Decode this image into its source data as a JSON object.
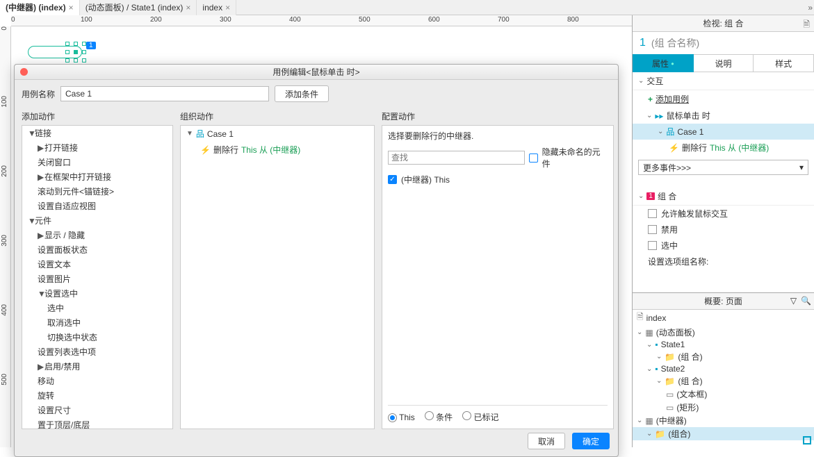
{
  "tabs": [
    {
      "label": "(中继器) (index)",
      "active": true
    },
    {
      "label": "(动态面板) / State1 (index)",
      "active": false
    },
    {
      "label": "index",
      "active": false
    }
  ],
  "ruler_h": [
    "0",
    "100",
    "200",
    "300",
    "400",
    "500",
    "600",
    "700",
    "800"
  ],
  "ruler_v": [
    "0",
    "100",
    "200",
    "300",
    "400",
    "500"
  ],
  "canvas": {
    "badge": "1"
  },
  "dialog": {
    "title": "用例编辑<鼠标单击 时>",
    "case_label": "用例名称",
    "case_name": "Case 1",
    "add_condition": "添加条件",
    "col1_h": "添加动作",
    "col2_h": "组织动作",
    "col3_h": "配置动作",
    "actions_tree": {
      "group1": "链接",
      "g1_items": [
        "打开链接",
        "关闭窗口",
        "在框架中打开链接",
        "滚动到元件<锚链接>",
        "设置自适应视图"
      ],
      "group2": "元件",
      "g2_items": [
        "显示 / 隐藏",
        "设置面板状态",
        "设置文本",
        "设置图片"
      ],
      "g2_sub": "设置选中",
      "g2_sub_items": [
        "选中",
        "取消选中",
        "切换选中状态"
      ],
      "g2_tail": [
        "设置列表选中项",
        "启用/禁用",
        "移动",
        "旋转",
        "设置尺寸",
        "置于顶层/底层"
      ]
    },
    "org_case": "Case 1",
    "org_action_prefix": "删除行",
    "org_action_link": "This 从 (中继器)",
    "cfg_label": "选择要删除行的中继器.",
    "cfg_search_ph": "查找",
    "cfg_hide_unnamed": "隐藏未命名的元件",
    "cfg_item_text": "(中继器) This",
    "radios": {
      "this": "This",
      "cond": "条件",
      "marked": "已标记"
    },
    "cancel": "取消",
    "ok": "确定"
  },
  "inspector": {
    "title": "检视: 组 合",
    "index": "1",
    "name": "(组 合名称)",
    "tabs": {
      "props": "属性",
      "notes": "说明",
      "style": "样式"
    },
    "sec_interact": "交互",
    "add_case": "添加用例",
    "event": "鼠标单击 时",
    "case": "Case 1",
    "action_prefix": "删除行",
    "action_link": "This 从 (中继器)",
    "more_events": "更多事件>>>",
    "sec_group": "组 合",
    "opt_trigger": "允许触发鼠标交互",
    "opt_disable": "禁用",
    "opt_selected": "选中",
    "opt_selgroup": "设置选项组名称:"
  },
  "outline": {
    "title": "概要: 页面",
    "items": [
      {
        "pad": 0,
        "icon": "page",
        "label": "index"
      },
      {
        "pad": 0,
        "icon": "dyn",
        "label": "(动态面板)",
        "caret": true
      },
      {
        "pad": 1,
        "icon": "state",
        "label": "State1",
        "caret": true
      },
      {
        "pad": 2,
        "icon": "folder",
        "label": "(组 合)",
        "caret": true
      },
      {
        "pad": 1,
        "icon": "state",
        "label": "State2",
        "caret": true
      },
      {
        "pad": 2,
        "icon": "folder",
        "label": "(组 合)",
        "caret": true
      },
      {
        "pad": 3,
        "icon": "rect",
        "label": "(文本框)"
      },
      {
        "pad": 3,
        "icon": "rect",
        "label": "(矩形)"
      },
      {
        "pad": 0,
        "icon": "rep",
        "label": "(中继器)",
        "caret": true
      },
      {
        "pad": 1,
        "icon": "folder",
        "label": "(组合)",
        "caret": true,
        "sel": true
      }
    ],
    "footer_icon": "square"
  }
}
